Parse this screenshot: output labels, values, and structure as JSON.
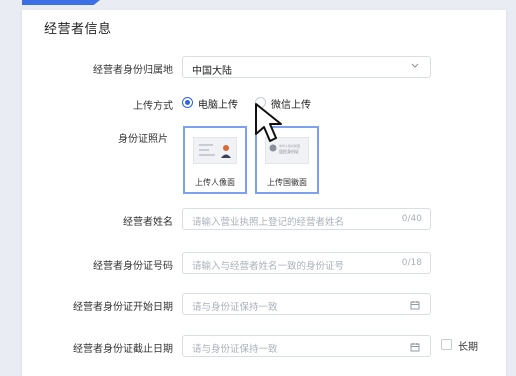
{
  "section": {
    "title": "经营者信息"
  },
  "region": {
    "label": "经营者身份归属地",
    "value": "中国大陆",
    "icon": "chevron-down-icon"
  },
  "upload_method": {
    "label": "上传方式",
    "options": [
      {
        "label": "电脑上传",
        "selected": true
      },
      {
        "label": "微信上传",
        "selected": false
      }
    ]
  },
  "id_photo": {
    "label": "身份证照片",
    "front": {
      "caption": "上传人像面"
    },
    "back": {
      "caption": "上传国徽面",
      "card_text_1": "中华人民共和国",
      "card_text_2": "居民身份证"
    }
  },
  "name": {
    "label": "经营者姓名",
    "placeholder": "请输入营业执照上登记的经营者姓名",
    "counter": "0/40"
  },
  "id_number": {
    "label": "经营者身份证号码",
    "placeholder": "请输入与经营者姓名一致的身份证号",
    "counter": "0/18"
  },
  "id_start": {
    "label": "经营者身份证开始日期",
    "placeholder": "请与身份证保持一致",
    "icon": "calendar-icon"
  },
  "id_end": {
    "label": "经营者身份证截止日期",
    "placeholder": "请与身份证保持一致",
    "icon": "calendar-icon",
    "long_term_label": "长期"
  },
  "colors": {
    "accent": "#2c63e6",
    "highlight_border": "#7da1ee",
    "page_bg": "#e9ecf2"
  }
}
